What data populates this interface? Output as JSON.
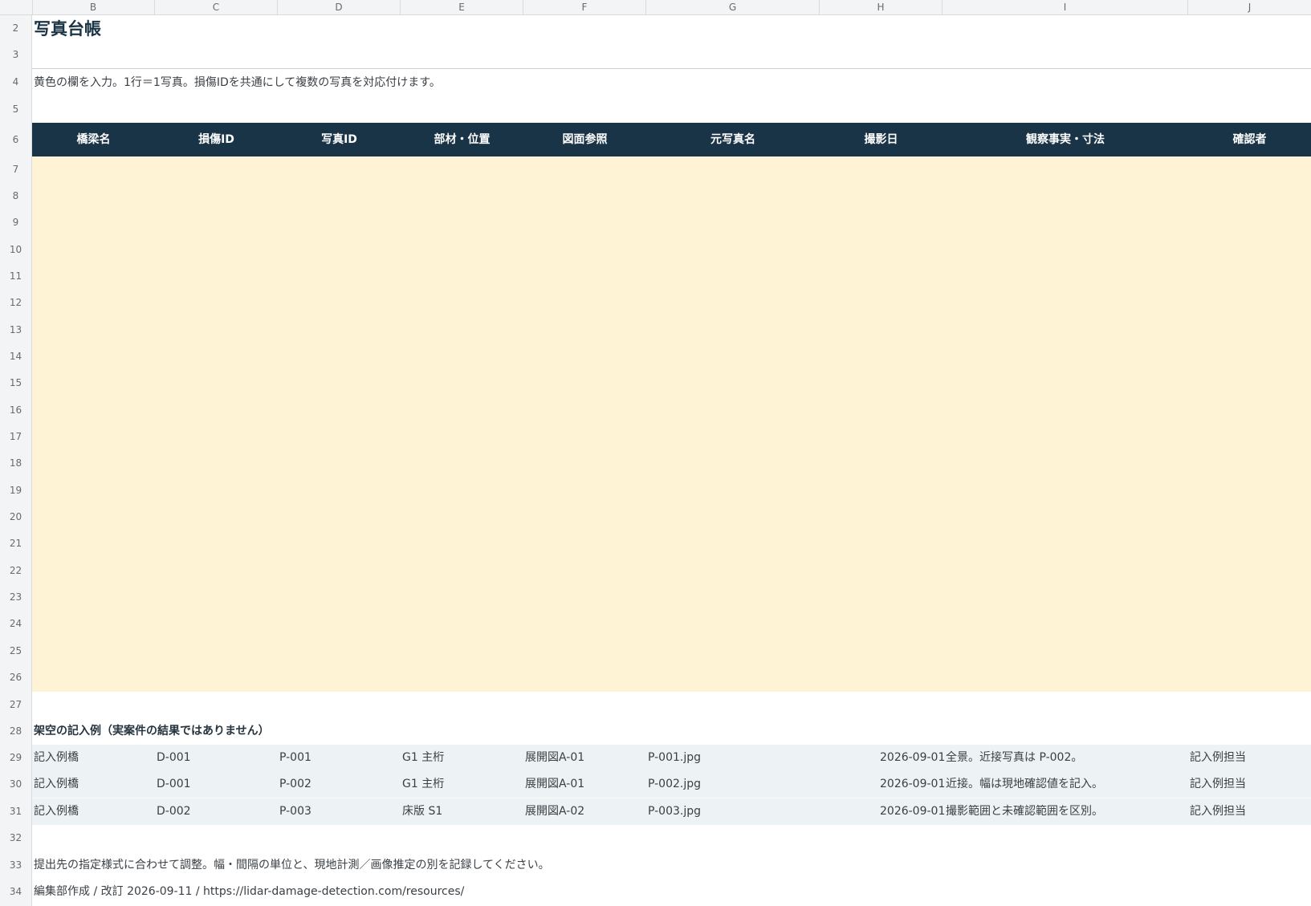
{
  "columns": [
    "B",
    "C",
    "D",
    "E",
    "F",
    "G",
    "H",
    "I",
    "J"
  ],
  "rows": [
    "2",
    "3",
    "4",
    "5",
    "6",
    "7",
    "8",
    "9",
    "10",
    "11",
    "12",
    "13",
    "14",
    "15",
    "16",
    "17",
    "18",
    "19",
    "20",
    "21",
    "22",
    "23",
    "24",
    "25",
    "26",
    "27",
    "28",
    "29",
    "30",
    "31",
    "32",
    "33",
    "34"
  ],
  "sheet": {
    "title": "写真台帳",
    "instruction": "黄色の欄を入力。1行＝1写真。損傷IDを共通にして複数の写真を対応付けます。",
    "headers": [
      "橋梁名",
      "損傷ID",
      "写真ID",
      "部材・位置",
      "図面参照",
      "元写真名",
      "撮影日",
      "観察事実・寸法",
      "確認者"
    ],
    "examples_title": "架空の記入例（実案件の結果ではありません）",
    "examples": [
      [
        "記入例橋",
        "D-001",
        "P-001",
        "G1 主桁",
        "展開図A-01",
        "P-001.jpg",
        "2026-09-01",
        "全景。近接写真は P-002。",
        "記入例担当"
      ],
      [
        "記入例橋",
        "D-001",
        "P-002",
        "G1 主桁",
        "展開図A-01",
        "P-002.jpg",
        "2026-09-01",
        "近接。幅は現地確認値を記入。",
        "記入例担当"
      ],
      [
        "記入例橋",
        "D-002",
        "P-003",
        "床版 S1",
        "展開図A-02",
        "P-003.jpg",
        "2026-09-01",
        "撮影範囲と未確認範囲を区別。",
        "記入例担当"
      ]
    ],
    "footer_note": "提出先の指定様式に合わせて調整。幅・間隔の単位と、現地計測／画像推定の別を記録してください。",
    "credit": "編集部作成 / 改訂 2026-09-11 / https://lidar-damage-detection.com/resources/"
  },
  "colors": {
    "header_bg": "#193447",
    "input_bg": "#fff3d6",
    "example_bg": "#edf2f5",
    "title_color": "#1b3445"
  }
}
